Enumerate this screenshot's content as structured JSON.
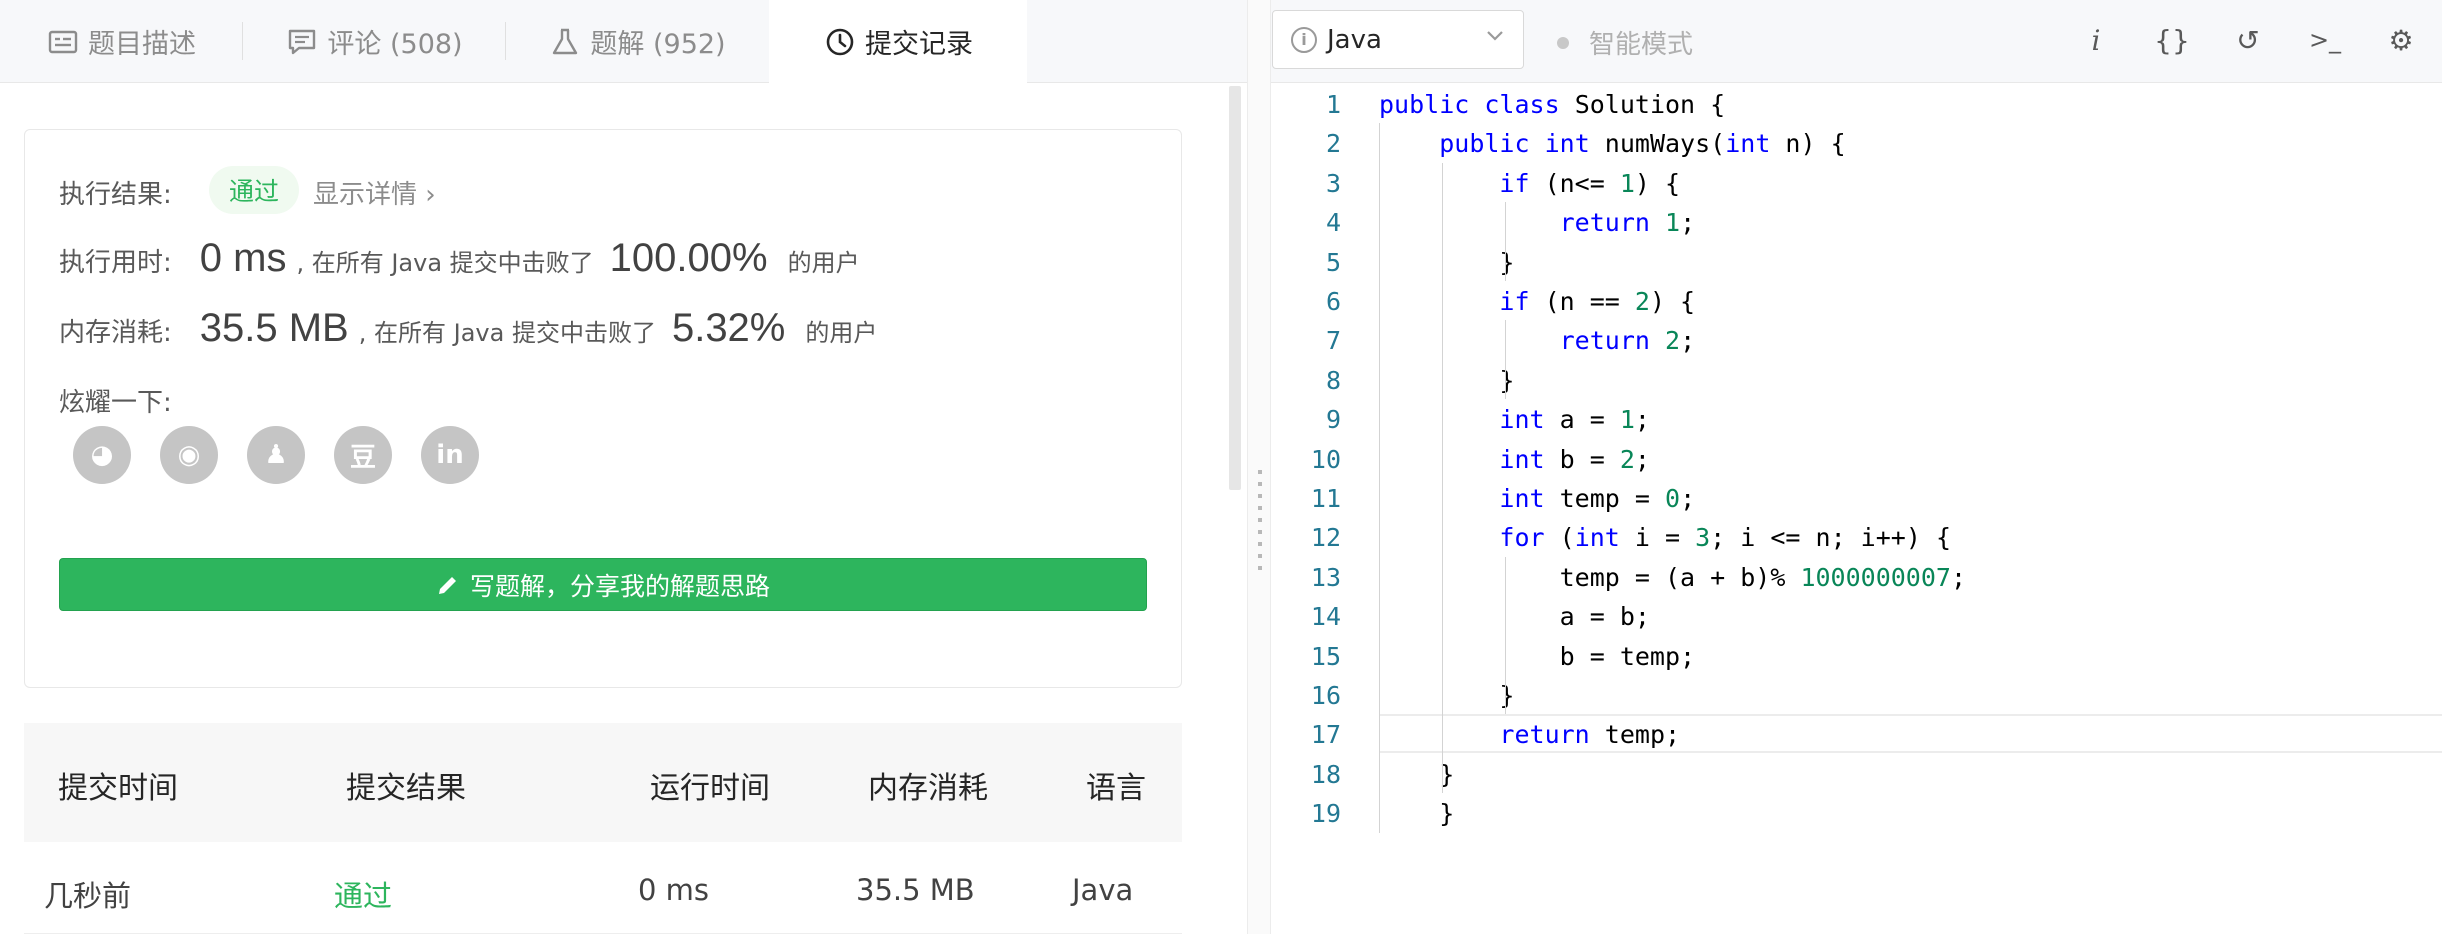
{
  "tabs": [
    {
      "label": "题目描述",
      "icon": "description-icon"
    },
    {
      "label": "评论 (508)",
      "icon": "comment-icon"
    },
    {
      "label": "题解 (952)",
      "icon": "flask-icon"
    },
    {
      "label": "提交记录",
      "icon": "clock-icon",
      "active": true
    }
  ],
  "result": {
    "exec_result_label": "执行结果:",
    "status": "通过",
    "show_detail": "显示详情 ›",
    "time_label": "执行用时:",
    "time_value": "0 ms",
    "time_text": ", 在所有 Java 提交中击败了",
    "time_percent": "100.00%",
    "time_suffix": "的用户",
    "mem_label": "内存消耗:",
    "mem_value": "35.5 MB",
    "mem_text": ", 在所有 Java 提交中击败了",
    "mem_percent": "5.32%",
    "mem_suffix": "的用户",
    "share_label": "炫耀一下:",
    "share_icons": [
      "wechat-icon",
      "weibo-icon",
      "qq-icon",
      "douban-icon",
      "linkedin-icon"
    ],
    "share_glyphs": [
      "◕",
      "◉",
      "♟",
      "豆",
      "in"
    ],
    "write_button": "写题解，分享我的解题思路"
  },
  "submissions": {
    "headers": [
      "提交时间",
      "提交结果",
      "运行时间",
      "内存消耗",
      "语言"
    ],
    "rows": [
      {
        "time": "几秒前",
        "result": "通过",
        "runtime": "0 ms",
        "memory": "35.5 MB",
        "language": "Java"
      }
    ]
  },
  "editor_toolbar": {
    "language": "Java",
    "smart_mode": "智能模式",
    "tools": [
      "info-icon",
      "braces-icon",
      "reset-icon",
      "console-icon",
      "settings-icon"
    ],
    "tool_glyphs": [
      "i",
      "{}",
      "↺",
      ">_",
      "⚙"
    ]
  },
  "code": {
    "current_line": 17,
    "lines": [
      "public class Solution {",
      "    public int numWays(int n) {",
      "        if (n<= 1) {",
      "            return 1;",
      "        }",
      "        if (n == 2) {",
      "            return 2;",
      "        }",
      "        int a = 1;",
      "        int b = 2;",
      "        int temp = 0;",
      "        for (int i = 3; i <= n; i++) {",
      "            temp = (a + b)% 1000000007;",
      "            a = b;",
      "            b = temp;",
      "        }",
      "        return temp;",
      "    }",
      "    }"
    ]
  },
  "colors": {
    "accent": "#2db55d",
    "keyword": "#0000ff",
    "number": "#098658",
    "line_number": "#237893"
  }
}
